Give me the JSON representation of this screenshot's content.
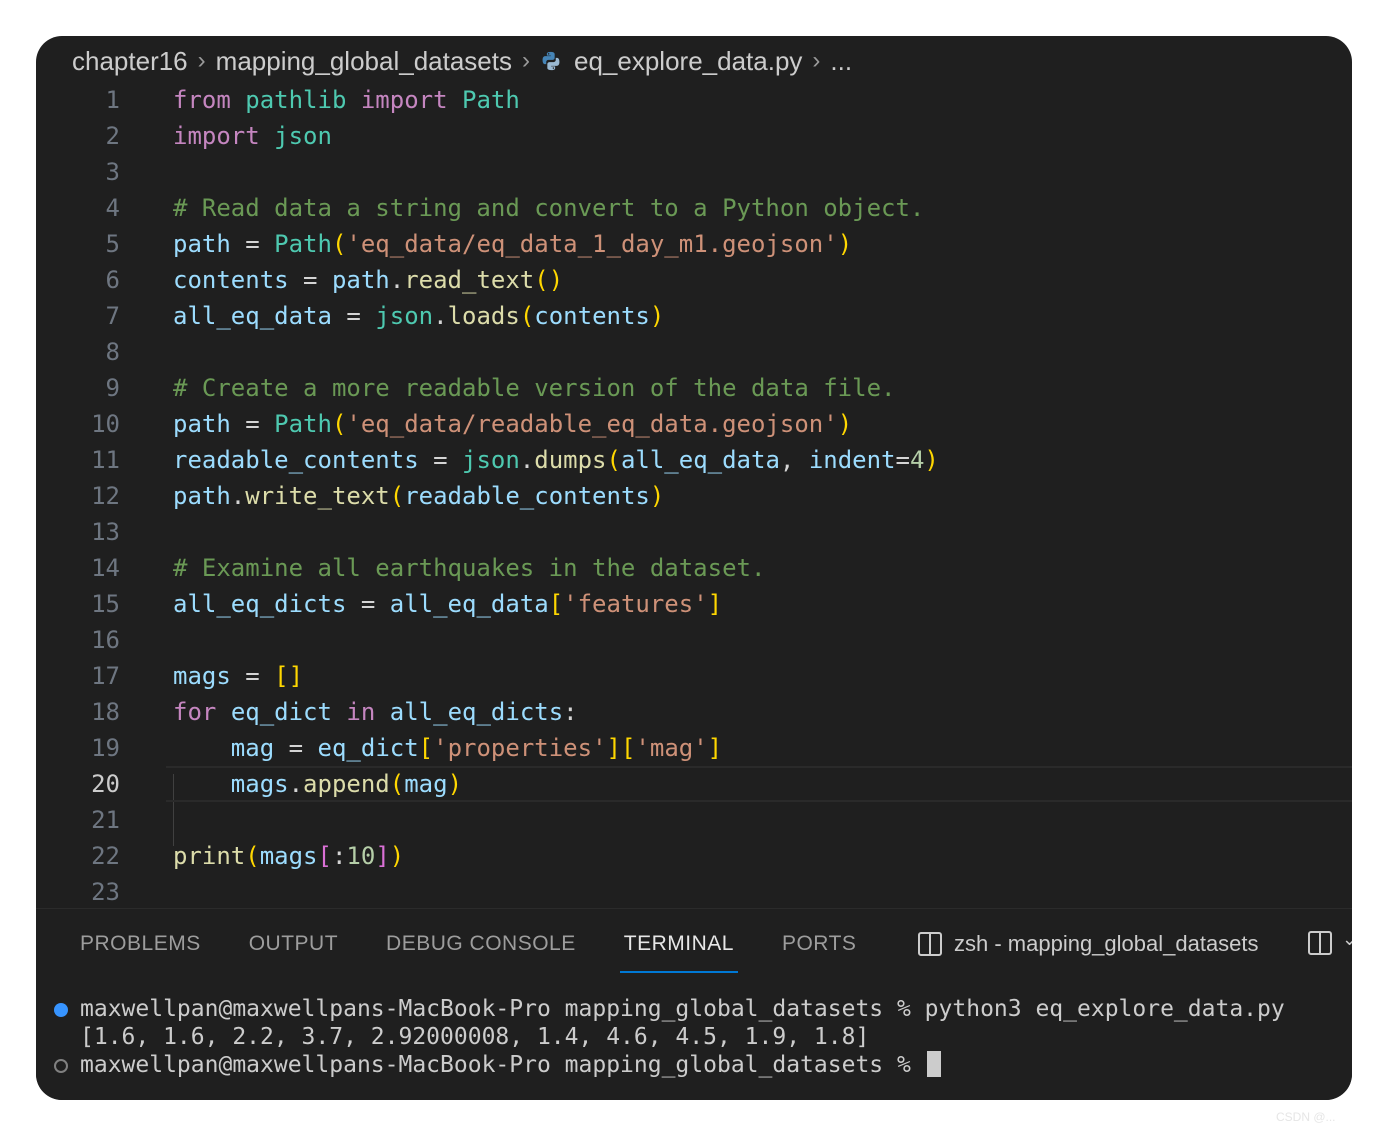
{
  "breadcrumb": {
    "items": [
      "chapter16",
      "mapping_global_datasets",
      "eq_explore_data.py",
      "..."
    ],
    "file_icon": "python-icon"
  },
  "editor": {
    "current_line": 20,
    "lines": [
      {
        "n": "1",
        "tokens": [
          [
            "kw",
            "from"
          ],
          [
            "op",
            " "
          ],
          [
            "cls",
            "pathlib"
          ],
          [
            "op",
            " "
          ],
          [
            "kw",
            "import"
          ],
          [
            "op",
            " "
          ],
          [
            "cls",
            "Path"
          ]
        ]
      },
      {
        "n": "2",
        "tokens": [
          [
            "kw",
            "import"
          ],
          [
            "op",
            " "
          ],
          [
            "cls",
            "json"
          ]
        ]
      },
      {
        "n": "3",
        "tokens": []
      },
      {
        "n": "4",
        "tokens": [
          [
            "cmt",
            "# Read data a string and convert to a Python object."
          ]
        ]
      },
      {
        "n": "5",
        "tokens": [
          [
            "var",
            "path"
          ],
          [
            "op",
            " = "
          ],
          [
            "cls",
            "Path"
          ],
          [
            "br1",
            "("
          ],
          [
            "str",
            "'eq_data/eq_data_1_day_m1.geojson'"
          ],
          [
            "br1",
            ")"
          ]
        ]
      },
      {
        "n": "6",
        "tokens": [
          [
            "var",
            "contents"
          ],
          [
            "op",
            " = "
          ],
          [
            "var",
            "path"
          ],
          [
            "op",
            "."
          ],
          [
            "fn",
            "read_text"
          ],
          [
            "br1",
            "()"
          ]
        ]
      },
      {
        "n": "7",
        "tokens": [
          [
            "var",
            "all_eq_data"
          ],
          [
            "op",
            " = "
          ],
          [
            "cls",
            "json"
          ],
          [
            "op",
            "."
          ],
          [
            "fn",
            "loads"
          ],
          [
            "br1",
            "("
          ],
          [
            "var",
            "contents"
          ],
          [
            "br1",
            ")"
          ]
        ]
      },
      {
        "n": "8",
        "tokens": []
      },
      {
        "n": "9",
        "tokens": [
          [
            "cmt",
            "# Create a more readable version of the data file."
          ]
        ]
      },
      {
        "n": "10",
        "tokens": [
          [
            "var",
            "path"
          ],
          [
            "op",
            " = "
          ],
          [
            "cls",
            "Path"
          ],
          [
            "br1",
            "("
          ],
          [
            "str",
            "'eq_data/readable_eq_data.geojson'"
          ],
          [
            "br1",
            ")"
          ]
        ]
      },
      {
        "n": "11",
        "tokens": [
          [
            "var",
            "readable_contents"
          ],
          [
            "op",
            " = "
          ],
          [
            "cls",
            "json"
          ],
          [
            "op",
            "."
          ],
          [
            "fn",
            "dumps"
          ],
          [
            "br1",
            "("
          ],
          [
            "var",
            "all_eq_data"
          ],
          [
            "op",
            ", "
          ],
          [
            "var",
            "indent"
          ],
          [
            "op",
            "="
          ],
          [
            "num",
            "4"
          ],
          [
            "br1",
            ")"
          ]
        ]
      },
      {
        "n": "12",
        "tokens": [
          [
            "var",
            "path"
          ],
          [
            "op",
            "."
          ],
          [
            "fn",
            "write_text"
          ],
          [
            "br1",
            "("
          ],
          [
            "var",
            "readable_contents"
          ],
          [
            "br1",
            ")"
          ]
        ]
      },
      {
        "n": "13",
        "tokens": []
      },
      {
        "n": "14",
        "tokens": [
          [
            "cmt",
            "# Examine all earthquakes in the dataset."
          ]
        ]
      },
      {
        "n": "15",
        "tokens": [
          [
            "var",
            "all_eq_dicts"
          ],
          [
            "op",
            " = "
          ],
          [
            "var",
            "all_eq_data"
          ],
          [
            "br1",
            "["
          ],
          [
            "str",
            "'features'"
          ],
          [
            "br1",
            "]"
          ]
        ]
      },
      {
        "n": "16",
        "tokens": []
      },
      {
        "n": "17",
        "tokens": [
          [
            "var",
            "mags"
          ],
          [
            "op",
            " = "
          ],
          [
            "br1",
            "[]"
          ]
        ]
      },
      {
        "n": "18",
        "tokens": [
          [
            "kw",
            "for"
          ],
          [
            "op",
            " "
          ],
          [
            "var",
            "eq_dict"
          ],
          [
            "op",
            " "
          ],
          [
            "kw",
            "in"
          ],
          [
            "op",
            " "
          ],
          [
            "var",
            "all_eq_dicts"
          ],
          [
            "op",
            ":"
          ]
        ]
      },
      {
        "n": "19",
        "tokens": [
          [
            "op",
            "    "
          ],
          [
            "var",
            "mag"
          ],
          [
            "op",
            " = "
          ],
          [
            "var",
            "eq_dict"
          ],
          [
            "br1",
            "["
          ],
          [
            "str",
            "'properties'"
          ],
          [
            "br1",
            "]["
          ],
          [
            "str",
            "'mag'"
          ],
          [
            "br1",
            "]"
          ]
        ]
      },
      {
        "n": "20",
        "tokens": [
          [
            "op",
            "    "
          ],
          [
            "var",
            "mags"
          ],
          [
            "op",
            "."
          ],
          [
            "fn",
            "append"
          ],
          [
            "br1",
            "("
          ],
          [
            "var",
            "mag"
          ],
          [
            "br1",
            ")"
          ]
        ]
      },
      {
        "n": "21",
        "tokens": []
      },
      {
        "n": "22",
        "tokens": [
          [
            "fn",
            "print"
          ],
          [
            "br1",
            "("
          ],
          [
            "var",
            "mags"
          ],
          [
            "br2",
            "["
          ],
          [
            "op",
            ":"
          ],
          [
            "num",
            "10"
          ],
          [
            "br2",
            "]"
          ],
          [
            "br1",
            ")"
          ]
        ]
      },
      {
        "n": "23",
        "tokens": []
      }
    ]
  },
  "panel": {
    "tabs": [
      "PROBLEMS",
      "OUTPUT",
      "DEBUG CONSOLE",
      "TERMINAL",
      "PORTS"
    ],
    "active_tab": "TERMINAL",
    "terminal_title": "zsh - mapping_global_datasets",
    "terminal_lines": [
      "maxwellpan@maxwellpans-MacBook-Pro mapping_global_datasets % python3 eq_explore_data.py",
      "[1.6, 1.6, 2.2, 3.7, 2.92000008, 1.4, 4.6, 4.5, 1.9, 1.8]",
      "maxwellpan@maxwellpans-MacBook-Pro mapping_global_datasets % "
    ]
  },
  "watermark": "CSDN @..."
}
